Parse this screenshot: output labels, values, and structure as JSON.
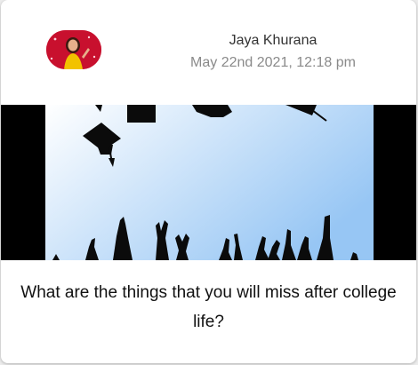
{
  "post": {
    "author": "Jaya Khurana",
    "date": "May 22nd 2021, 12:18 pm",
    "avatar_icon": "user-avatar-photo",
    "image_icon": "graduation-caps-celebration-image",
    "question": "What are the things that you will miss after college life?"
  },
  "colors": {
    "avatar_bg": "#c8102e",
    "image_sky_top": "#ffffff",
    "image_sky_bottom": "#97c6f4",
    "silhouette": "#0b0b0b"
  }
}
